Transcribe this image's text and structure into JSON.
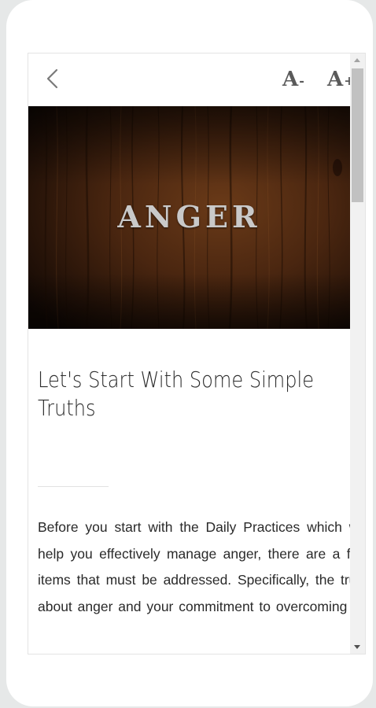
{
  "toolbar": {
    "back_icon": "chevron-left-icon",
    "font_decrease_label": "A",
    "font_decrease_sign": "-",
    "font_increase_label": "A",
    "font_increase_sign": "+"
  },
  "hero": {
    "title": "ANGER",
    "background": "dark wood texture"
  },
  "article": {
    "title": "Let's Start With Some Simple Truths",
    "body": "Before you start with the Daily Practices which will help you effectively manage anger, there are a few items that must be addressed. Specifically, the truth about anger and your commitment to overcoming it."
  },
  "colors": {
    "page_background": "#e6e8e8",
    "device": "#ffffff",
    "text": "#2a2a2a",
    "toolbar_icons": "#5a5a5a",
    "scrollbar_track": "#f1f1f1",
    "scrollbar_thumb": "#c1c1c1"
  }
}
